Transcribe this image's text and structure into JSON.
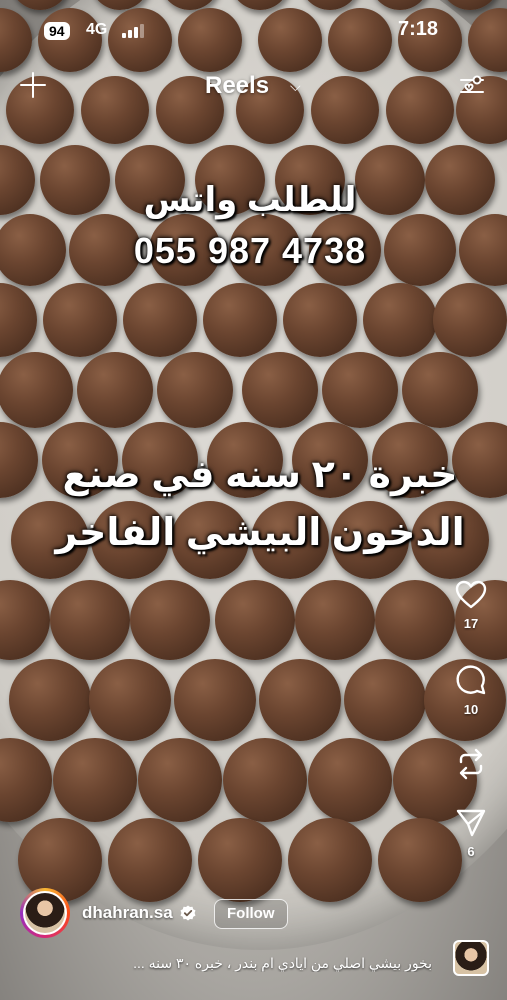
{
  "status_bar": {
    "battery": "94",
    "network": "4G",
    "time": "7:18"
  },
  "header": {
    "title": "Reels",
    "left_icon": "plus-icon",
    "title_icon": "chevron-down-icon",
    "right_icon": "filter-icon"
  },
  "overlay": {
    "order_text": "للطلب واتس",
    "phone": "055 987 4738",
    "promo_line1": "خبرة ٢٠ سنه في صنع",
    "promo_line2": "الدخون البيشي الفاخر"
  },
  "actions": {
    "likes": "17",
    "comments": "10",
    "shares": "",
    "sends": "6"
  },
  "author": {
    "username": "dhahran.sa",
    "follow_label": "Follow"
  },
  "caption": "بخور بيشي اصلي  من ايادي ام بندر ، خبره ٣٠ سنه ...",
  "colors": {
    "accent": "#ffffff",
    "avatar_ring_start": "#f7b733",
    "avatar_ring_end": "#962fbf"
  }
}
